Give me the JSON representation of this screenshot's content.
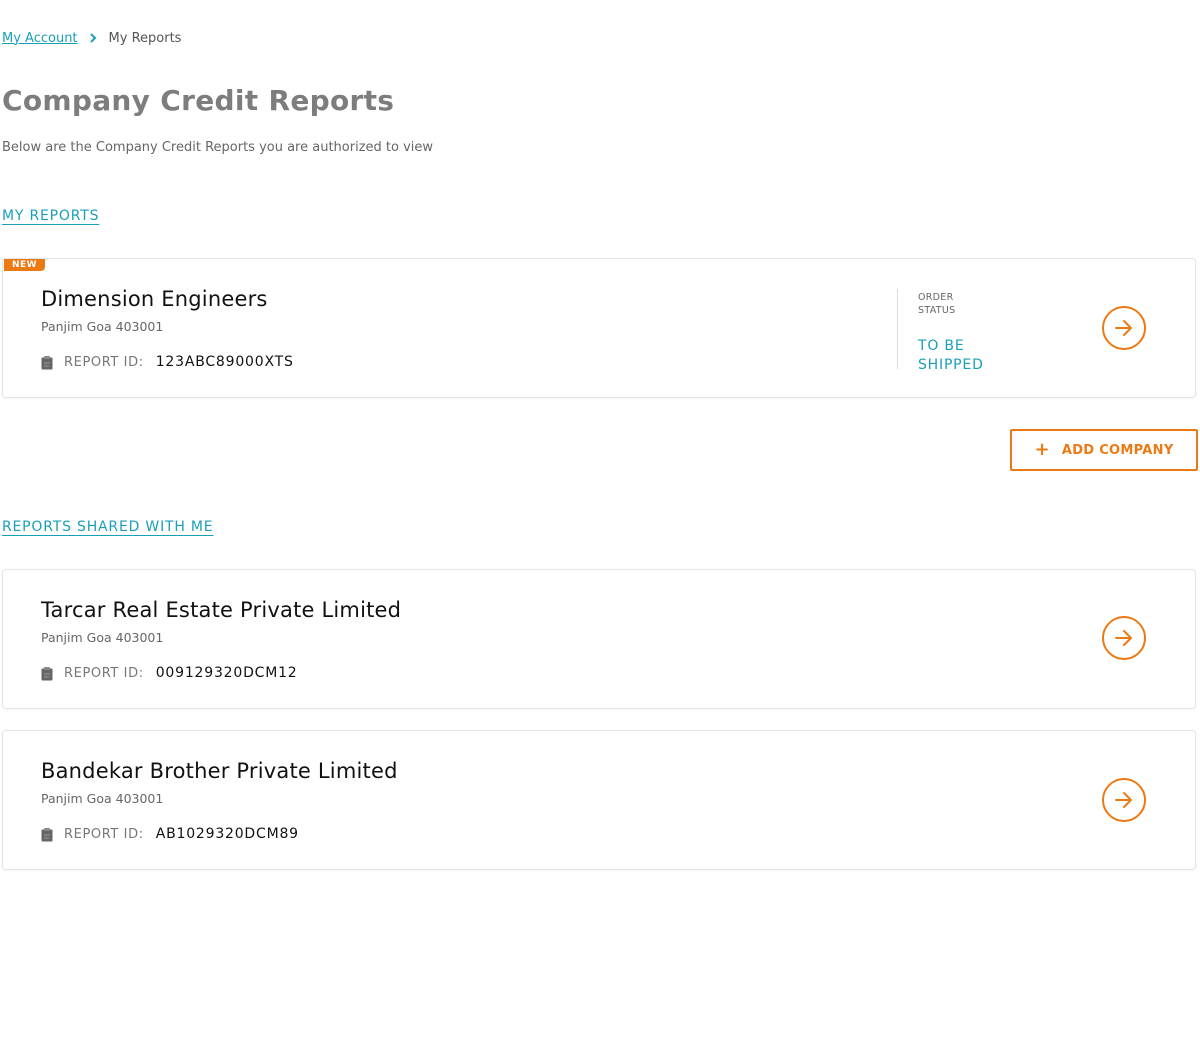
{
  "breadcrumb": {
    "items": [
      {
        "label": "My Account"
      },
      {
        "label": "My Reports"
      }
    ]
  },
  "page": {
    "title": "Company Credit Reports",
    "subtitle": "Below are the Company Credit Reports you are authorized to view"
  },
  "my_reports": {
    "heading": "MY REPORTS",
    "cards": [
      {
        "badge": "NEW",
        "company": "Dimension Engineers",
        "address": "Panjim Goa 403001",
        "report_id_label": "REPORT ID:",
        "report_id": "123ABC89000XTS",
        "status_label": "ORDER STATUS",
        "status_value": "TO BE SHIPPED"
      }
    ],
    "add_button_label": "ADD COMPANY"
  },
  "shared_reports": {
    "heading": "REPORTS SHARED WITH ME",
    "cards": [
      {
        "company": "Tarcar Real Estate Private Limited",
        "address": "Panjim Goa 403001",
        "report_id_label": "REPORT ID:",
        "report_id": "009129320DCM12"
      },
      {
        "company": "Bandekar Brother Private Limited",
        "address": "Panjim Goa 403001",
        "report_id_label": "REPORT ID:",
        "report_id": "AB1029320DCM89"
      }
    ]
  },
  "colors": {
    "accent": "#ec7a14",
    "link": "#1a9fb8",
    "title": "#7d7d7d"
  },
  "icons": {
    "breadcrumb_separator": "chevron-right-icon",
    "report": "clipboard-icon",
    "open_card": "arrow-right-icon",
    "add": "plus-icon"
  }
}
